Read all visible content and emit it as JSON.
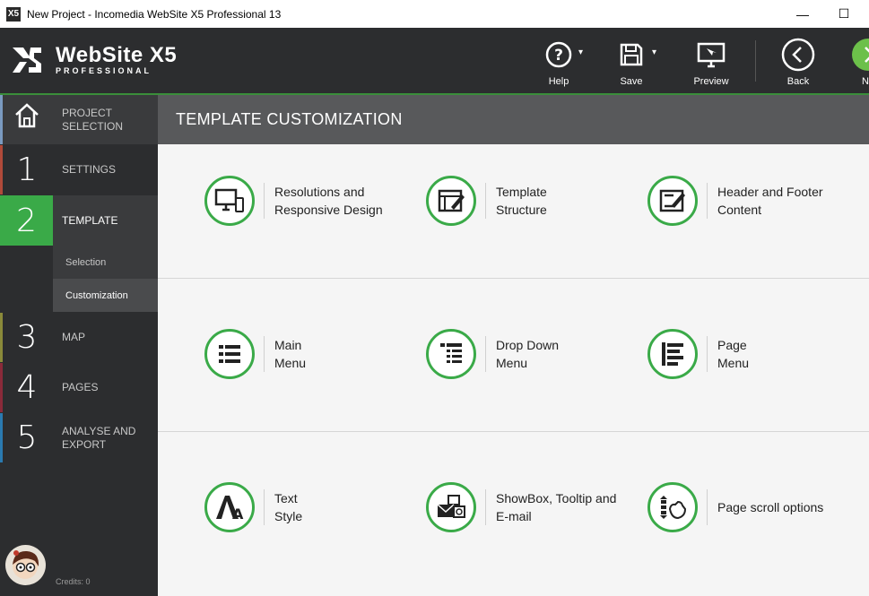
{
  "window": {
    "title": "New Project - Incomedia WebSite X5 Professional 13",
    "minimize": "—",
    "maximize": "☐"
  },
  "logo": {
    "name": "WebSite X5",
    "edition": "PROFESSIONAL"
  },
  "toolbar": {
    "help": "Help",
    "save": "Save",
    "preview": "Preview",
    "back": "Back",
    "next": "Ne"
  },
  "sidebar": {
    "home_label": "PROJECT\nSELECTION",
    "steps": [
      {
        "num": "1",
        "label": "SETTINGS"
      },
      {
        "num": "2",
        "label": "TEMPLATE"
      },
      {
        "num": "3",
        "label": "MAP"
      },
      {
        "num": "4",
        "label": "PAGES"
      },
      {
        "num": "5",
        "label": "ANALYSE AND\nEXPORT"
      }
    ],
    "sub_selection": "Selection",
    "sub_customization": "Customization",
    "credits": "Credits: 0"
  },
  "main": {
    "title": "TEMPLATE CUSTOMIZATION",
    "items": [
      {
        "label": "Resolutions and\nResponsive Design",
        "icon": "devices-icon"
      },
      {
        "label": "Template\nStructure",
        "icon": "template-structure-icon"
      },
      {
        "label": "Header and Footer\nContent",
        "icon": "header-footer-icon"
      },
      {
        "label": "Main\nMenu",
        "icon": "main-menu-icon"
      },
      {
        "label": "Drop Down\nMenu",
        "icon": "dropdown-menu-icon"
      },
      {
        "label": "Page\nMenu",
        "icon": "page-menu-icon"
      },
      {
        "label": "Text\nStyle",
        "icon": "text-style-icon"
      },
      {
        "label": "ShowBox, Tooltip and\nE-mail",
        "icon": "showbox-icon"
      },
      {
        "label": "Page scroll options",
        "icon": "page-scroll-icon"
      }
    ]
  },
  "colors": {
    "accent": "#3aaa48",
    "dark": "#2c2d2f",
    "section": "#58595b"
  }
}
